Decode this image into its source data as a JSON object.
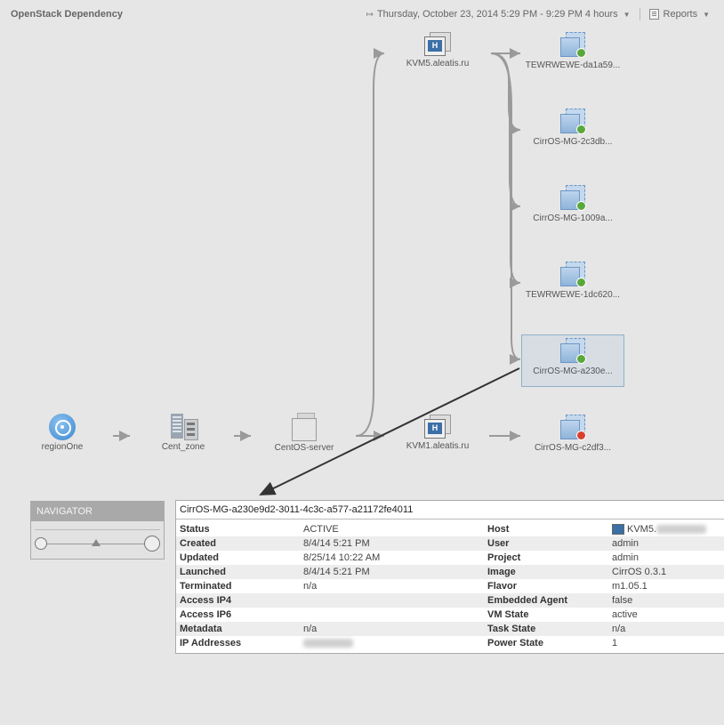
{
  "header": {
    "title": "OpenStack Dependency",
    "time_range": "Thursday, October 23, 2014 5:29 PM - 9:29 PM 4 hours",
    "reports_label": "Reports"
  },
  "nodes": {
    "region": "regionOne",
    "zone": "Cent_zone",
    "server": "CentOS-server",
    "host1": "KVM5.aleatis.ru",
    "host2": "KVM1.aleatis.ru",
    "vm1": "TEWRWEWE-da1a59...",
    "vm2": "CirrOS-MG-2c3db...",
    "vm3": "CirrOS-MG-1009a...",
    "vm4": "TEWRWEWE-1dc620...",
    "vm5": "CirrOS-MG-a230e...",
    "vm6": "CirrOS-MG-c2df3..."
  },
  "navigator": {
    "title": "NAVIGATOR"
  },
  "details": {
    "title": "CirrOS-MG-a230e9d2-3011-4c3c-a577-a21172fe4011",
    "rows": [
      {
        "k1": "Status",
        "v1": "ACTIVE",
        "k2": "Host",
        "v2": "KVM5."
      },
      {
        "k1": "Created",
        "v1": "8/4/14 5:21 PM",
        "k2": "User",
        "v2": "admin"
      },
      {
        "k1": "Updated",
        "v1": "8/25/14 10:22 AM",
        "k2": "Project",
        "v2": "admin"
      },
      {
        "k1": "Launched",
        "v1": "8/4/14 5:21 PM",
        "k2": "Image",
        "v2": "CirrOS 0.3.1"
      },
      {
        "k1": "Terminated",
        "v1": "n/a",
        "k2": "Flavor",
        "v2": "m1.05.1"
      },
      {
        "k1": "Access IP4",
        "v1": "",
        "k2": "Embedded Agent",
        "v2": "false"
      },
      {
        "k1": "Access IP6",
        "v1": "",
        "k2": "VM State",
        "v2": "active"
      },
      {
        "k1": "Metadata",
        "v1": "n/a",
        "k2": "Task State",
        "v2": "n/a"
      },
      {
        "k1": "IP Addresses",
        "v1": "",
        "k2": "Power State",
        "v2": "1"
      }
    ]
  },
  "colors": {
    "edge": "#9a9a9a",
    "pointer_arrow": "#333333",
    "status_ok": "#5aa83c",
    "status_error": "#d9402f",
    "selection": "#8fb0cc"
  }
}
